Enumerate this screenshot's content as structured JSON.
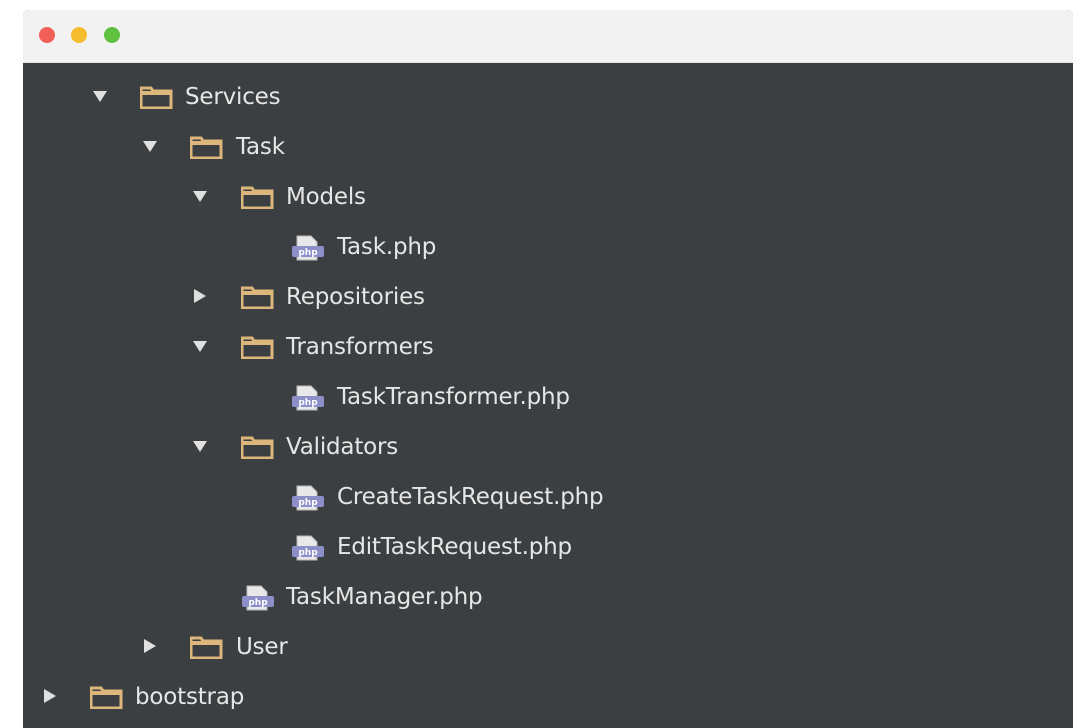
{
  "window": {
    "traffic_lights": {
      "close_color": "#f25f58",
      "minimize_color": "#f5bd2d",
      "maximize_color": "#5ec23f"
    }
  },
  "colors": {
    "panel_background": "#3c3f41",
    "titlebar_background": "#f2f2f2",
    "folder_icon": "#dcb67a",
    "php_icon": "#8c8fc8",
    "text": "#e6e6e6"
  },
  "tree": {
    "services": {
      "label": "Services",
      "icon": "folder-icon",
      "state": "expanded"
    },
    "task": {
      "label": "Task",
      "icon": "folder-icon",
      "state": "expanded"
    },
    "models": {
      "label": "Models",
      "icon": "folder-icon",
      "state": "expanded"
    },
    "task_php": {
      "label": "Task.php",
      "icon": "php-file-icon",
      "badge": "php"
    },
    "repositories": {
      "label": "Repositories",
      "icon": "folder-icon",
      "state": "collapsed"
    },
    "transformers": {
      "label": "Transformers",
      "icon": "folder-icon",
      "state": "expanded"
    },
    "task_transformer_php": {
      "label": "TaskTransformer.php",
      "icon": "php-file-icon",
      "badge": "php"
    },
    "validators": {
      "label": "Validators",
      "icon": "folder-icon",
      "state": "expanded"
    },
    "create_task_request_php": {
      "label": "CreateTaskRequest.php",
      "icon": "php-file-icon",
      "badge": "php"
    },
    "edit_task_request_php": {
      "label": "EditTaskRequest.php",
      "icon": "php-file-icon",
      "badge": "php"
    },
    "task_manager_php": {
      "label": "TaskManager.php",
      "icon": "php-file-icon",
      "badge": "php"
    },
    "user": {
      "label": "User",
      "icon": "folder-icon",
      "state": "collapsed"
    },
    "bootstrap": {
      "label": "bootstrap",
      "icon": "folder-icon",
      "state": "collapsed"
    }
  }
}
